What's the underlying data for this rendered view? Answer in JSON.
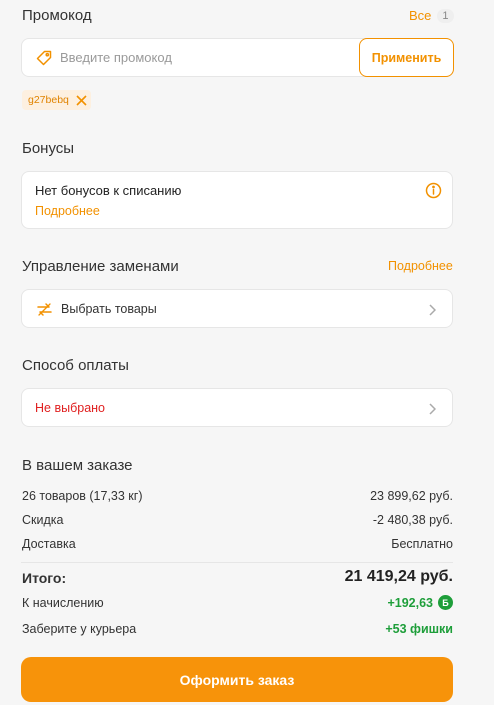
{
  "promo": {
    "title": "Промокод",
    "all_link": "Все",
    "count": "1",
    "placeholder": "Введите промокод",
    "apply_label": "Применить",
    "applied_code": "g27bebq"
  },
  "bonuses": {
    "title": "Бонусы",
    "message": "Нет бонусов к списанию",
    "more_link": "Подробнее"
  },
  "replacements": {
    "title": "Управление заменами",
    "more_link": "Подробнее",
    "select_label": "Выбрать товары"
  },
  "payment": {
    "title": "Способ оплаты",
    "value": "Не выбрано"
  },
  "order": {
    "title": "В вашем заказе",
    "items_label": "26 товаров (17,33 кг)",
    "items_value": "23 899,62 руб.",
    "discount_label": "Скидка",
    "discount_value": "-2 480,38 руб.",
    "delivery_label": "Доставка",
    "delivery_value": "Бесплатно",
    "total_label": "Итого:",
    "total_value": "21 419,24 руб.",
    "accrual_label": "К начислению",
    "accrual_value": "+192,63",
    "accrual_badge": "Б",
    "courier_label": "Заберите у курьера",
    "courier_value": "+53 фишки",
    "submit_label": "Оформить заказ"
  },
  "colors": {
    "accent": "#f29100",
    "positive": "#1e9e3a",
    "error": "#e02020",
    "background": "#f6f6f6"
  }
}
